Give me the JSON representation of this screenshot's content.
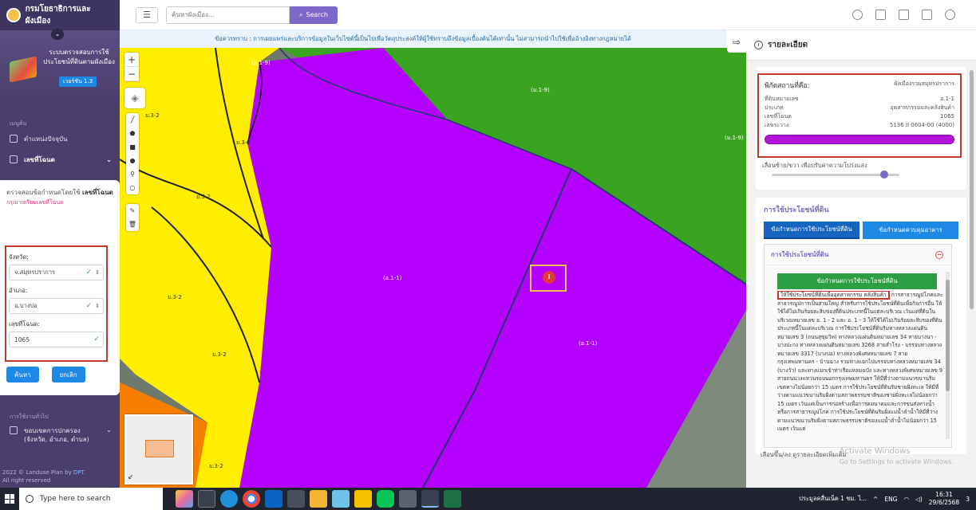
{
  "app": {
    "brand": "กรมโยธาธิการและผังเมือง",
    "hero_title": "ระบบตรวจสอบการใช้ประโยชน์ที่ดินตามผังเมือง",
    "version": "เวอร์ชัน 1.3"
  },
  "sidebar": {
    "section_menu": "เมนูค้น",
    "items": [
      {
        "label": "ตำแหน่งปัจจุบัน",
        "icon": "location-icon"
      },
      {
        "label": "เลขที่โฉนด",
        "icon": "document-icon"
      }
    ],
    "section_other": "การใช้งานทั่วไป",
    "lower_item": "ขอบเขตการปกครอง (จังหวัด, อำเภอ, ตำบล)",
    "copyright": "2022 © Landuse Plan by",
    "copyright_link": "DPT.",
    "rights": "All right reserved"
  },
  "search_card": {
    "hint_prefix": "ตรวจสอบข้อกำหนดโดยใช้",
    "hint_bold": "เลขที่โฉนด",
    "hint_note": "กรุณาเตรียมเลขที่โฉนด",
    "province_label": "จังหวัด:",
    "province_value": "จ.สมุทรปราการ",
    "district_label": "อำเภอ:",
    "district_value": "อ.บางบ่อ",
    "deed_label": "เลขที่โฉนด:",
    "deed_value": "1065",
    "search_button": "ค้นหา",
    "cancel_button": "ยกเลิก"
  },
  "topbar": {
    "search_placeholder": "ค้นหาผังเมือง...",
    "search_button": "Search"
  },
  "notice": "ข้อควรทราบ : การเผยแพร่และบริการข้อมูลในเว็บไซต์นี้เป็นไปเพื่อวัตถุประสงค์ให้ผู้ใช้ทราบถึงข้อมูลเบื้องต้นได้เท่านั้น ไม่สามารถนำไปใช้เพื่ออ้างอิงทางกฎหมายได้",
  "map": {
    "zoom_in": "+",
    "zoom_out": "−",
    "labels": {
      "l1": "(ม.1-9)",
      "l2": "(ม.1-9)",
      "l3": "(ม.1-9)",
      "l4": "(ม.1-9)",
      "l5": "ย.3-2",
      "l6": "ย.3-2",
      "l7": "ย.3-2",
      "l8": "ย.3-2",
      "l9": "ย.3-2",
      "l10": "ย.3-2",
      "l11": "(อ.1-1)",
      "l12": "(อ.1-1)",
      "l13": "(ม.1-9)"
    },
    "marker": "i"
  },
  "panel": {
    "title": "รายละเอียด",
    "location_label": "พิกัดสถานที่คือ:",
    "location_value": "ผังเมืองรวมสมุทรปราการ",
    "rows": [
      {
        "label": "ที่ดินหมายเลข",
        "value": "อ.1-1"
      },
      {
        "label": "ประเภท",
        "value": "อุตสาหกรรมและคลังสินค้า"
      },
      {
        "label": "เลขที่โฉนด",
        "value": "1065"
      },
      {
        "label": "เลขระวาง",
        "value": "5136 II 0604-00 (4000)"
      }
    ],
    "slider_hint": "เลื่อนซ้าย/ขวา เพื่อปรับค่าความโปร่งแสง",
    "slider_level": 0.88,
    "landuse_title": "การใช้ประโยชน์ที่ดิน",
    "tab1": "ข้อกำหนดการใช้ประโยชน์ที่ดิน",
    "tab2": "ข้อกำหนดควบคุมอาคาร",
    "accordion_title": "การใช้ประโยชน์ที่ดิน",
    "green_bar": "ข้อกำหนดการใช้ประโยชน์ที่ดิน",
    "highlight_text": "ให้ใช้ประโยชน์ที่ดินเพื่ออุตสาหกรรม คลังสินค้า",
    "body_text": "การสาธารณูปโภคและสาธารณูปการเป็นส่วนใหญ่ สำหรับการใช้ประโยชน์ที่ดินเพื่อกิจการอื่น ให้ใช้ได้ไม่เกินร้อยละสิบของที่ดินประเภทนี้ในแต่ละบริเวณ เว้นแต่ที่ดินในบริเวณหมายเลข อ. 1 - 2 และ อ. 1 - 3 ให้ใช้ได้ไม่เกินร้อยละสิบของที่ดินประเภทนี้ในแต่ละบริเวณ การใช้ประโยชน์ที่ดินริมทางหลวงแผ่นดินหมายเลข 3 (ถนนสุขุมวิท) ทางหลวงแผ่นดินหมายเลข 34 สายบางนา - บางปะกง ทางหลวงแผ่นดินหมายเลข 3268 สายสำโรง - บรรจบทางหลวงหมายเลข 3317 (บางบ่อ) ทางหลวงพิเศษหมายเลข 7 สายกรุงเทพมหานคร - บ้านฉาง รวมทางแยกไปบรรจบทางหลวงหมายเลข 34 (บางวัว) และทางแยกเข้าท่าเรือแหลมฉบัง และทางหลวงพิเศษหมายเลข 9 สายถนนวงแหวนรอบนอกกรุงเทพมหานคร ให้มีที่ว่างตามแนวขนานริมเขตทางไม่น้อยกว่า 15 เมตร การใช้ประโยชน์ที่ดินริมชายฝั่งทะเล ให้มีที่ว่างตามแนวขนานริมฝั่งตามสภาพธรรมชาติของชายฝั่งทะเลไม่น้อยกว่า 15 เมตร เว้นแต่เป็นการก่อสร้างเพื่อการคมนาคมและการขนส่งทางน้ำหรือการสาธารณูปโภค การใช้ประโยชน์ที่ดินริมฝั่งแม่น้ำลำน้ำให้มีที่ว่างตามแนวขนานริมฝั่งตามสภาพธรรมชาติของแม่น้ำลำน้ำไม่น้อยกว่า 15 เมตร เว้นแต่",
    "footer_hint": "เลื่อนขึ้น/ลง ดูรายละเอียดเพิ่มเติม",
    "activate_title": "Activate Windows",
    "activate_sub": "Go to Settings to activate Windows."
  },
  "taskbar": {
    "search_placeholder": "Type here to search",
    "notification": "ประมูลคลื่นเน็ต 1 ชม. ไ...",
    "lang": "ENG",
    "time": "16:31",
    "date": "29/6/2568",
    "badge": "3"
  }
}
